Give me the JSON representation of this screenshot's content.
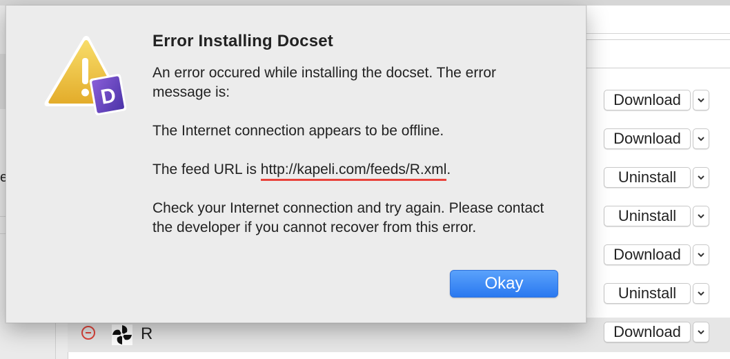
{
  "dialog": {
    "title": "Error Installing Docset",
    "message_intro": "An error occured while installing the docset. The error message is:",
    "error_message": "The Internet connection appears to be offline.",
    "feed_prefix": "The feed URL is ",
    "feed_url": "http://kapeli.com/feeds/R.xml",
    "feed_suffix": ".",
    "advice": "Check your Internet connection and try again. Please contact the developer if you cannot recover from this error.",
    "okay_label": "Okay",
    "icon": "warning-triangle-dash-icon"
  },
  "sidebar": {
    "partial_text": "e"
  },
  "docset_rows": [
    {
      "action": "Download"
    },
    {
      "action": "Download"
    },
    {
      "action": "Uninstall"
    },
    {
      "action": "Uninstall"
    },
    {
      "action": "Download"
    },
    {
      "action": "Uninstall"
    },
    {
      "action": "Download"
    }
  ],
  "selected_docset": {
    "name": "R",
    "icon": "r-docset-icon"
  },
  "colors": {
    "okay_button": "#2a78f0",
    "url_underline": "#e8413a",
    "remove_icon": "#e0443a"
  }
}
